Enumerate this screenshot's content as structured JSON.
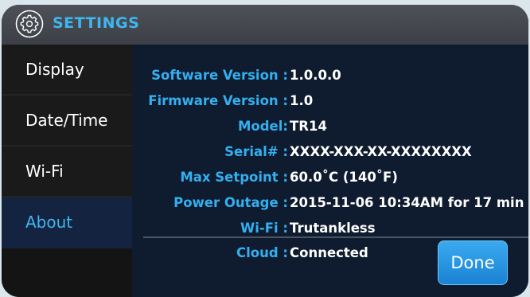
{
  "header": {
    "title": "SETTINGS",
    "icon": "gear-icon"
  },
  "colors": {
    "accent": "#3fb6f0",
    "label": "#34aff0",
    "value": "#ffffff",
    "active_tab_bg": "#142440",
    "button": "#2196e6"
  },
  "sidebar": {
    "items": [
      {
        "label": "Display"
      },
      {
        "label": "Date/Time"
      },
      {
        "label": "Wi-Fi"
      },
      {
        "label": "About",
        "active": true
      }
    ]
  },
  "about": {
    "rows": [
      {
        "label": "Software Version :",
        "value": "1.0.0.0"
      },
      {
        "label": "Firmware Version :",
        "value": "1.0"
      },
      {
        "label": "Model:",
        "value": "TR14"
      },
      {
        "label": "Serial# :",
        "value": "XXXX-XXX-XX-XXXXXXXX"
      },
      {
        "label": "Max Setpoint :",
        "value": "60.0˚C (140˚F)"
      },
      {
        "label": "Power Outage :",
        "value": "2015-11-06 10:34AM for 17 min"
      },
      {
        "label": "Wi-Fi :",
        "value": "Trutankless"
      },
      {
        "label": "Cloud :",
        "value": "Connected"
      }
    ]
  },
  "done_label": "Done"
}
